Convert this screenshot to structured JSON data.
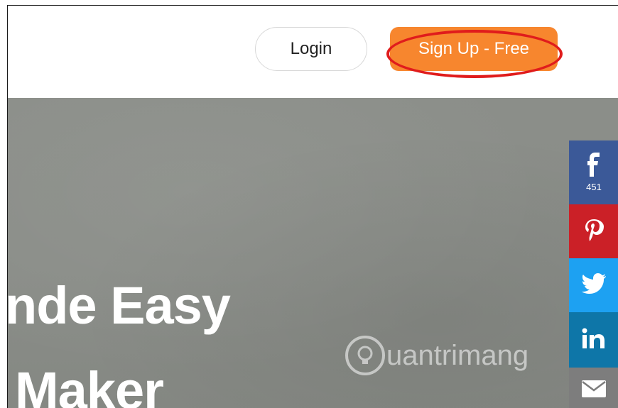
{
  "header": {
    "login_label": "Login",
    "signup_label": "Sign Up - Free"
  },
  "hero": {
    "line1": "nde Easy",
    "line2": "Maker"
  },
  "share": {
    "facebook_count": "451",
    "items": [
      "facebook-icon",
      "pinterest-icon",
      "twitter-icon",
      "linkedin-icon",
      "mail-icon"
    ]
  },
  "watermark": {
    "text": "uantrimang"
  },
  "colors": {
    "signup": "#f7862e",
    "highlight": "#e01c1c",
    "facebook": "#3b5998",
    "pinterest": "#cb2027",
    "twitter": "#1da1f2",
    "linkedin": "#0e76a8",
    "mail": "#7d7d7d"
  }
}
